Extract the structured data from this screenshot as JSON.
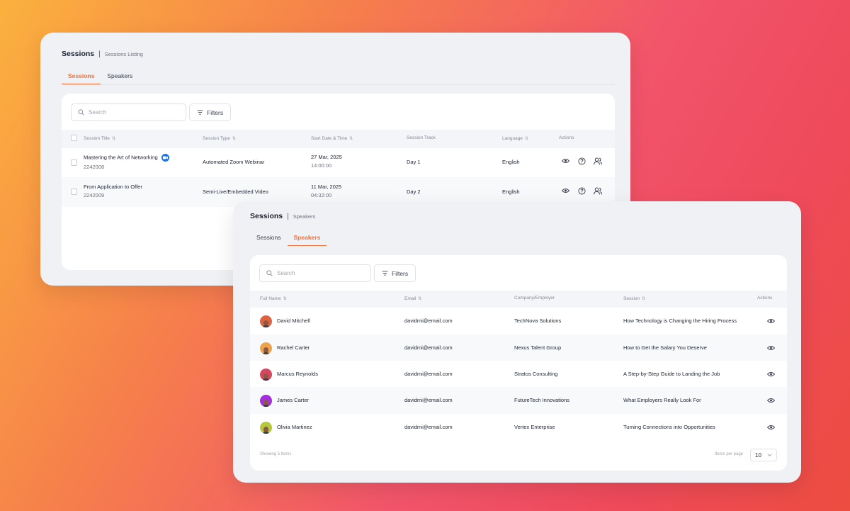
{
  "colors": {
    "accent": "#f2703b",
    "zoom_blue": "#1a73e8"
  },
  "sessions_card": {
    "title": "Sessions",
    "separator": "|",
    "subtitle": "Sessions Listing",
    "tabs": [
      {
        "label": "Sessions",
        "active": true
      },
      {
        "label": "Speakers",
        "active": false
      }
    ],
    "search_placeholder": "Search",
    "filters_label": "Filters",
    "columns": [
      "Session Title",
      "Session Type",
      "Start Date & Time",
      "Session Track",
      "Language",
      "Actions"
    ],
    "rows": [
      {
        "title": "Mastering the Art of Networking",
        "id": "2242008",
        "type": "Automated Zoom Webinar",
        "date": "27 Mar, 2025",
        "time": "14:00:00",
        "track": "Day 1",
        "language": "English",
        "zoom": true
      },
      {
        "title": "From Application to Offer",
        "id": "2242009",
        "type": "Semi-Live/Embedded Video",
        "date": "11 Mar, 2025",
        "time": "04:32:00",
        "track": "Day 2",
        "language": "English",
        "zoom": false
      }
    ]
  },
  "speakers_card": {
    "title": "Sessions",
    "separator": "|",
    "subtitle": "Speakers",
    "tabs": [
      {
        "label": "Sessions",
        "active": false
      },
      {
        "label": "Speakers",
        "active": true
      }
    ],
    "search_placeholder": "Search",
    "filters_label": "Filters",
    "columns": [
      "Full Name",
      "Email",
      "Company/Employer",
      "Session",
      "Actions"
    ],
    "rows": [
      {
        "name": "David Mitchell",
        "email": "davidmi@email.com",
        "company": "TechNova Solutions",
        "session": "How Technology is Changing the Hiring Process",
        "avatar_color": "#e2613f"
      },
      {
        "name": "Rachel Carter",
        "email": "davidmi@email.com",
        "company": "Nexus Talent Group",
        "session": "How to Get the Salary You Deserve",
        "avatar_color": "#f0a24a"
      },
      {
        "name": "Marcus Reynolds",
        "email": "davidmi@email.com",
        "company": "Stratos Consulting",
        "session": "A Step-by-Step Guide to Landing the Job",
        "avatar_color": "#d8455e"
      },
      {
        "name": "James Carter",
        "email": "davidmi@email.com",
        "company": "FutureTech Innovations",
        "session": "What Employers Really Look For",
        "avatar_color": "#a42ee0"
      },
      {
        "name": "Olivia Martinez",
        "email": "davidmi@email.com",
        "company": "Vertex Enterprise",
        "session": "Turning Connections into Opportunities",
        "avatar_color": "#b4c83a"
      }
    ],
    "footer_showing": "Showing 5 Items",
    "items_per_page_label": "Items per page",
    "items_per_page_value": "10"
  }
}
